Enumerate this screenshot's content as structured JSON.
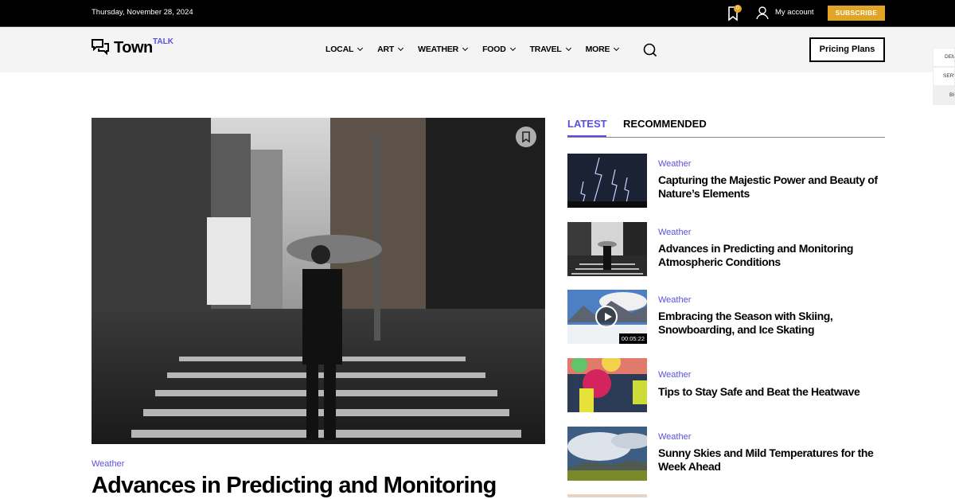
{
  "topbar": {
    "date": "Thursday, November 28, 2024",
    "bookmark_count": "0",
    "account_label": "My account",
    "subscribe_label": "SUBSCRIBE"
  },
  "header": {
    "logo_main": "Town",
    "logo_super": "TALK",
    "nav": [
      "LOCAL",
      "ART",
      "WEATHER",
      "FOOD",
      "TRAVEL",
      "MORE"
    ],
    "pricing_label": "Pricing Plans"
  },
  "side_tabs": [
    "DEMOS",
    "SERVICES",
    "BUY"
  ],
  "hero": {
    "category": "Weather",
    "title": "Advances in Predicting and Monitoring"
  },
  "tabs": {
    "latest": "LATEST",
    "recommended": "RECOMMENDED"
  },
  "latest": [
    {
      "category": "Weather",
      "title": "Capturing the Majestic Power and Beauty of Nature’s Elements"
    },
    {
      "category": "Weather",
      "title": "Advances in Predicting and Monitoring Atmospheric Conditions"
    },
    {
      "category": "Weather",
      "title": "Embracing the Season with Skiing, Snowboarding, and Ice Skating",
      "duration": "00:05:22"
    },
    {
      "category": "Weather",
      "title": "Tips to Stay Safe and Beat the Heatwave"
    },
    {
      "category": "Weather",
      "title": "Sunny Skies and Mild Temperatures for the Week Ahead"
    }
  ],
  "colors": {
    "accent": "#5b4fe0",
    "subscribe": "#e0a526"
  }
}
